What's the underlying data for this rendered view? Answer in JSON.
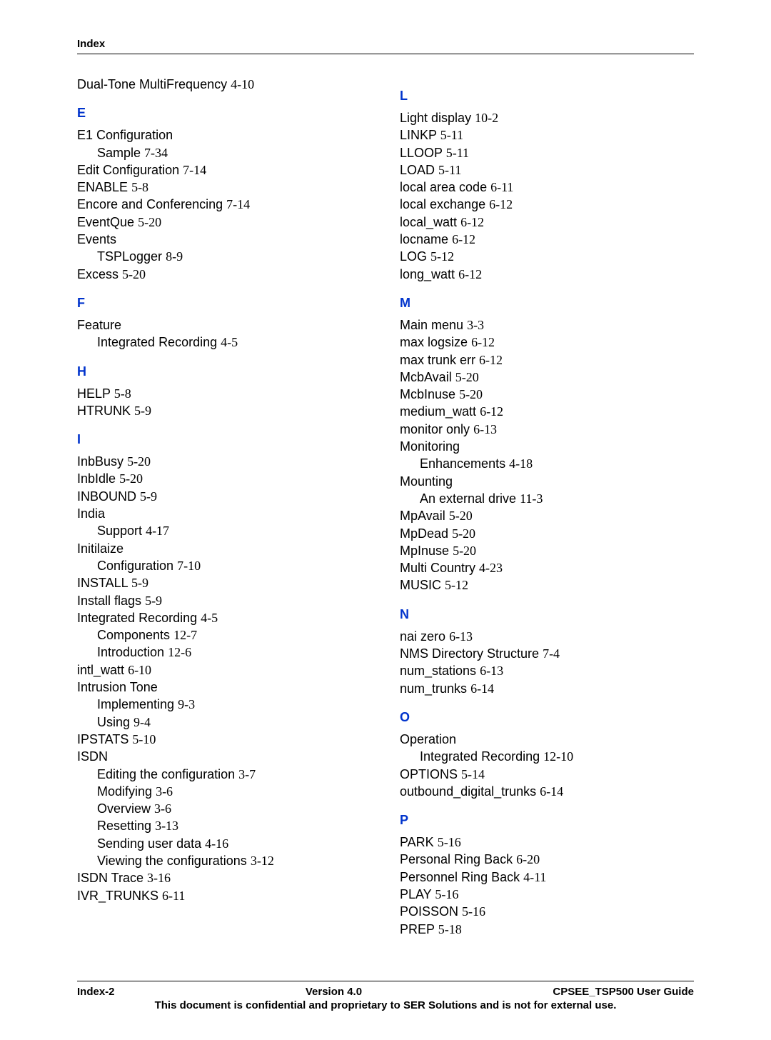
{
  "header": {
    "title": "Index"
  },
  "col1": {
    "pre": [
      {
        "text": "Dual-Tone MultiFrequency",
        "ref": "4-10"
      }
    ],
    "sections": [
      {
        "letter": "E",
        "items": [
          {
            "text": "E1 Configuration"
          },
          {
            "text": "Sample",
            "ref": "7-34",
            "sub": true
          },
          {
            "text": "Edit Configuration",
            "ref": "7-14"
          },
          {
            "text": "ENABLE",
            "ref": "5-8"
          },
          {
            "text": "Encore and Conferencing",
            "ref": "7-14"
          },
          {
            "text": "EventQue",
            "ref": "5-20"
          },
          {
            "text": "Events"
          },
          {
            "text": "TSPLogger",
            "ref": "8-9",
            "sub": true
          },
          {
            "text": "Excess",
            "ref": "5-20"
          }
        ]
      },
      {
        "letter": "F",
        "items": [
          {
            "text": "Feature"
          },
          {
            "text": "Integrated Recording",
            "ref": "4-5",
            "sub": true
          }
        ]
      },
      {
        "letter": "H",
        "items": [
          {
            "text": "HELP",
            "ref": "5-8"
          },
          {
            "text": "HTRUNK",
            "ref": "5-9"
          }
        ]
      },
      {
        "letter": "I",
        "items": [
          {
            "text": "InbBusy",
            "ref": "5-20"
          },
          {
            "text": "InbIdle",
            "ref": "5-20"
          },
          {
            "text": "INBOUND",
            "ref": "5-9"
          },
          {
            "text": "India"
          },
          {
            "text": "Support",
            "ref": "4-17",
            "sub": true
          },
          {
            "text": "Initilaize"
          },
          {
            "text": "Configuration",
            "ref": "7-10",
            "sub": true
          },
          {
            "text": "INSTALL",
            "ref": "5-9"
          },
          {
            "text": "Install flags",
            "ref": "5-9"
          },
          {
            "text": "Integrated Recording",
            "ref": "4-5"
          },
          {
            "text": "Components",
            "ref": "12-7",
            "sub": true
          },
          {
            "text": "Introduction",
            "ref": "12-6",
            "sub": true
          },
          {
            "text": "intl_watt",
            "ref": "6-10"
          },
          {
            "text": "Intrusion Tone"
          },
          {
            "text": "Implementing",
            "ref": "9-3",
            "sub": true
          },
          {
            "text": "Using",
            "ref": "9-4",
            "sub": true
          },
          {
            "text": "IPSTATS",
            "ref": "5-10"
          },
          {
            "text": "ISDN"
          },
          {
            "text": "Editing the configuration",
            "ref": "3-7",
            "sub": true
          },
          {
            "text": "Modifying",
            "ref": "3-6",
            "sub": true
          },
          {
            "text": "Overview",
            "ref": "3-6",
            "sub": true
          },
          {
            "text": "Resetting",
            "ref": "3-13",
            "sub": true
          },
          {
            "text": "Sending user data",
            "ref": "4-16",
            "sub": true
          },
          {
            "text": "Viewing the configurations",
            "ref": "3-12",
            "sub": true
          },
          {
            "text": "ISDN Trace",
            "ref": "3-16"
          },
          {
            "text": "IVR_TRUNKS",
            "ref": "6-11"
          }
        ]
      }
    ]
  },
  "col2": {
    "sections": [
      {
        "letter": "L",
        "items": [
          {
            "text": "Light display",
            "ref": "10-2"
          },
          {
            "text": "LINKP",
            "ref": "5-11"
          },
          {
            "text": "LLOOP",
            "ref": "5-11"
          },
          {
            "text": "LOAD",
            "ref": "5-11"
          },
          {
            "text": "local area code",
            "ref": "6-11"
          },
          {
            "text": "local exchange",
            "ref": "6-12"
          },
          {
            "text": "local_watt",
            "ref": "6-12"
          },
          {
            "text": "locname",
            "ref": "6-12"
          },
          {
            "text": "LOG",
            "ref": "5-12"
          },
          {
            "text": "long_watt",
            "ref": "6-12"
          }
        ]
      },
      {
        "letter": "M",
        "items": [
          {
            "text": "Main menu",
            "ref": "3-3"
          },
          {
            "text": "max logsize",
            "ref": "6-12"
          },
          {
            "text": "max trunk err",
            "ref": "6-12"
          },
          {
            "text": "McbAvail",
            "ref": "5-20"
          },
          {
            "text": "McbInuse",
            "ref": "5-20"
          },
          {
            "text": "medium_watt",
            "ref": "6-12"
          },
          {
            "text": "monitor only",
            "ref": "6-13"
          },
          {
            "text": "Monitoring"
          },
          {
            "text": "Enhancements",
            "ref": "4-18",
            "sub": true
          },
          {
            "text": "Mounting"
          },
          {
            "text": "An external drive",
            "ref": "11-3",
            "sub": true
          },
          {
            "text": "MpAvail",
            "ref": "5-20"
          },
          {
            "text": "MpDead",
            "ref": "5-20"
          },
          {
            "text": "MpInuse",
            "ref": "5-20"
          },
          {
            "text": "Multi Country",
            "ref": "4-23"
          },
          {
            "text": "MUSIC",
            "ref": "5-12"
          }
        ]
      },
      {
        "letter": "N",
        "items": [
          {
            "text": "nai zero",
            "ref": "6-13"
          },
          {
            "text": "NMS Directory Structure",
            "ref": "7-4"
          },
          {
            "text": "num_stations",
            "ref": "6-13"
          },
          {
            "text": "num_trunks",
            "ref": "6-14"
          }
        ]
      },
      {
        "letter": "O",
        "items": [
          {
            "text": "Operation"
          },
          {
            "text": "Integrated Recording",
            "ref": "12-10",
            "sub": true
          },
          {
            "text": "OPTIONS",
            "ref": "5-14"
          },
          {
            "text": "outbound_digital_trunks",
            "ref": "6-14"
          }
        ]
      },
      {
        "letter": "P",
        "items": [
          {
            "text": "PARK",
            "ref": "5-16"
          },
          {
            "text": "Personal Ring Back",
            "ref": "6-20"
          },
          {
            "text": "Personnel Ring Back",
            "ref": "4-11"
          },
          {
            "text": "PLAY",
            "ref": "5-16"
          },
          {
            "text": "POISSON",
            "ref": "5-16"
          },
          {
            "text": "PREP",
            "ref": "5-18"
          }
        ]
      }
    ]
  },
  "footer": {
    "left": "Index-2",
    "center": "Version 4.0",
    "right": "CPSEE_TSP500 User Guide",
    "note": "This document is confidential and proprietary to SER Solutions and is not for external use."
  }
}
